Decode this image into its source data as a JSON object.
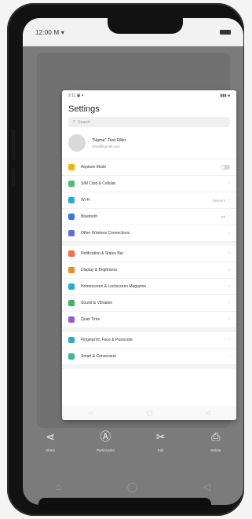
{
  "status_bar": {
    "time": "12:00 M ▾"
  },
  "card": {
    "mini_status_left": "2:11 ▣ ▾",
    "mini_status_right": "▮▮▮ ■",
    "title": "Settings",
    "search_placeholder": "Search",
    "account": {
      "name": "\"Name\" Text Filler",
      "sub": "email@gmail.com"
    },
    "groups": [
      [
        {
          "label": "Airplane Mode",
          "icon_color": "#f6b300",
          "kind": "toggle"
        },
        {
          "label": "SIM Card & Cellular",
          "icon_color": "#49c06b",
          "kind": "chevron"
        },
        {
          "label": "Wi-Fi",
          "icon_color": "#24a8f2",
          "value": "Network",
          "kind": "chevron"
        },
        {
          "label": "Bluetooth",
          "icon_color": "#2f7be7",
          "value": "Off",
          "kind": "chevron"
        },
        {
          "label": "Other Wireless Connections",
          "icon_color": "#5b6ef5",
          "kind": "chevron"
        }
      ],
      [
        {
          "label": "Notification & Status Bar",
          "icon_color": "#ff6b3d",
          "kind": "chevron"
        },
        {
          "label": "Display & Brightness",
          "icon_color": "#f78b22",
          "kind": "chevron"
        },
        {
          "label": "Homescreen & Lockscreen Magazine",
          "icon_color": "#2aa7e9",
          "kind": "chevron"
        },
        {
          "label": "Sound & Vibration",
          "icon_color": "#36b866",
          "kind": "chevron"
        },
        {
          "label": "Quiet Time",
          "icon_color": "#8c5cf0",
          "kind": "chevron"
        }
      ],
      [
        {
          "label": "Fingerprint, Face & Passcode",
          "icon_color": "#20b3c7",
          "kind": "chevron"
        },
        {
          "label": "Smart & Convenient",
          "icon_color": "#3ab99a",
          "kind": "chevron"
        }
      ]
    ],
    "nav": {
      "left": "▭",
      "home": "◯",
      "back": "◁"
    }
  },
  "actions": [
    {
      "icon": "share-icon",
      "glyph": "⋖",
      "label": "Share"
    },
    {
      "icon": "partial-scroll-icon",
      "glyph": "Ⓐ",
      "label": "Partial print"
    },
    {
      "icon": "edit-icon",
      "glyph": "✂",
      "label": "Edit"
    },
    {
      "icon": "delete-icon",
      "glyph": "⎙",
      "label": "Delete"
    }
  ],
  "bottom_nav": {
    "recent": "⌂",
    "home": "◯",
    "back": "◁"
  }
}
